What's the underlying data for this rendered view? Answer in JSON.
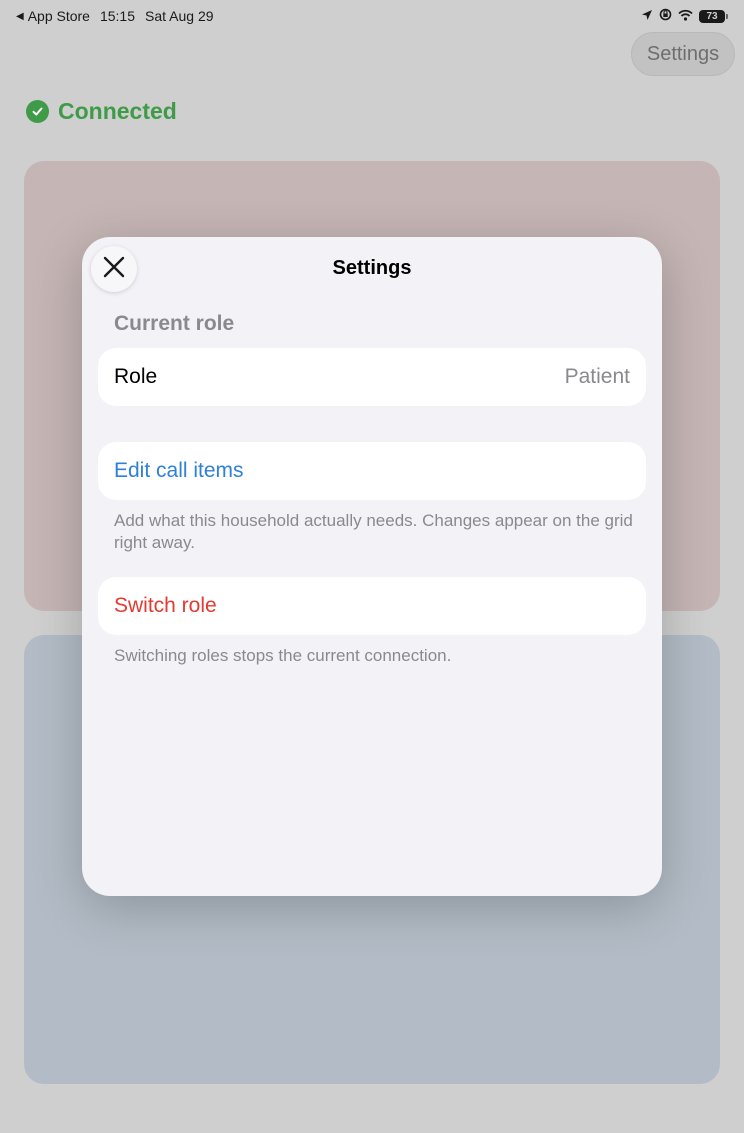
{
  "status_bar": {
    "back_app": "App Store",
    "time": "15:15",
    "date": "Sat Aug 29",
    "battery": "73",
    "icons": [
      "location-arrow-icon",
      "orientation-lock-icon",
      "wifi-icon",
      "battery-icon"
    ]
  },
  "background": {
    "settings_button": "Settings",
    "connection_status": "Connected",
    "colors": {
      "connected": "#3f9b47",
      "panel_top": "#c5b5b5",
      "panel_bottom": "#b3bcc6"
    }
  },
  "modal": {
    "title": "Settings",
    "close_icon": "close-icon",
    "current_role_header": "Current role",
    "role_label": "Role",
    "role_value": "Patient",
    "edit_call_items": "Edit call items",
    "edit_footnote": "Add what this household actually needs. Changes appear on the grid right away.",
    "switch_role": "Switch role",
    "switch_footnote": "Switching roles stops the current connection.",
    "colors": {
      "link": "#2f80d9",
      "destructive": "#e23b32",
      "secondary_text": "#8a8a8e"
    }
  }
}
